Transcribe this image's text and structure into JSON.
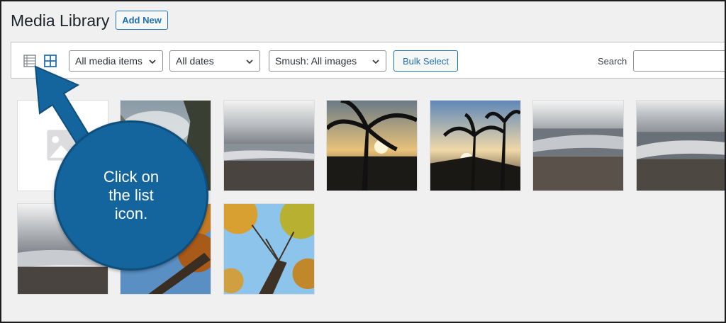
{
  "header": {
    "title": "Media Library",
    "add_new_label": "Add New"
  },
  "toolbar": {
    "view_list_icon": "list-view-icon",
    "view_grid_icon": "grid-view-icon",
    "media_filter": "All media items",
    "date_filter": "All dates",
    "smush_filter": "Smush: All images",
    "bulk_select_label": "Bulk Select",
    "search_label": "Search",
    "search_value": ""
  },
  "gallery": {
    "items": [
      {
        "name": "placeholder-image",
        "kind": "placeholder"
      },
      {
        "name": "cloudy-trees",
        "kind": "photo"
      },
      {
        "name": "beach-waves-1",
        "kind": "photo"
      },
      {
        "name": "palm-sunset-1",
        "kind": "photo"
      },
      {
        "name": "palm-sunset-2",
        "kind": "photo"
      },
      {
        "name": "beach-waves-2",
        "kind": "photo"
      },
      {
        "name": "beach-waves-3",
        "kind": "photo"
      },
      {
        "name": "beach-waves-4",
        "kind": "photo"
      },
      {
        "name": "autumn-tree-1",
        "kind": "photo"
      },
      {
        "name": "autumn-tree-2",
        "kind": "photo"
      }
    ]
  },
  "callout": {
    "text": "Click on\nthe list\nicon.",
    "color": "#14659d"
  },
  "colors": {
    "accent": "#2271b1",
    "background": "#f0f0f1"
  }
}
